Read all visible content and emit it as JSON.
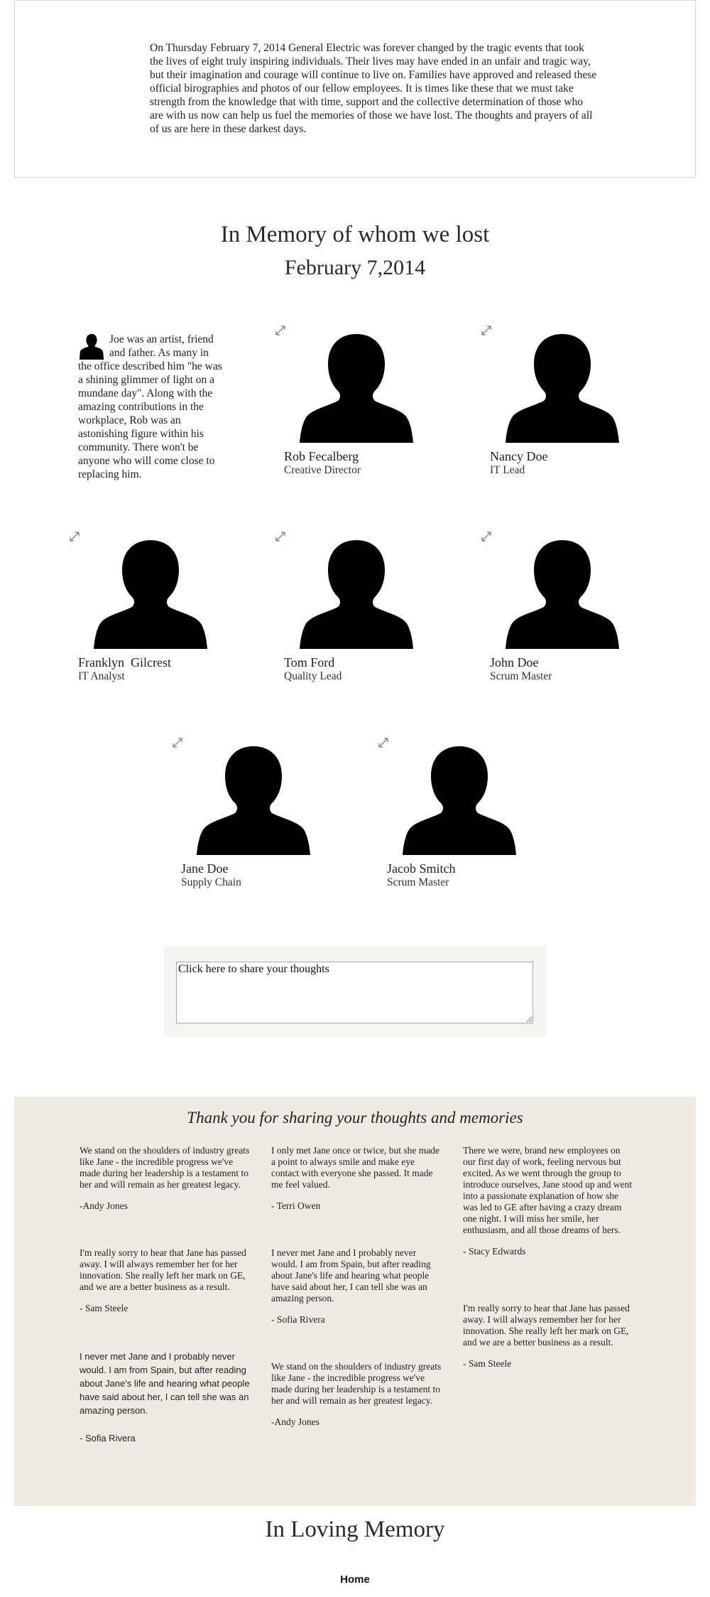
{
  "intro": {
    "text": "On Thursday February 7, 2014 General Electric was forever changed by the tragic events that took the lives of eight truly inspiring individuals. Their lives may have ended in an unfair and tragic way, but their imagination and courage will continue to live on. Families have approved and released these official birographies and photos of our fellow employees. It is times like these that we must take strength from the knowledge that with time, support and the collective determination of those who are with us now can help us fuel the memories of those we have lost. The thoughts and prayers of all of us are here in these darkest days."
  },
  "memorial": {
    "title": "In Memory of whom we lost",
    "date": "February 7,2014"
  },
  "bio": {
    "text": "Joe was an artist, friend and father. As many in the office described him \"he was a shining glimmer of light on a mundane day\". Along with the amazing contributions in the workplace, Rob was an astonishing figure within his community. There won't be anyone who will come close to replacing him."
  },
  "people": [
    {
      "name": "Rob Fecalberg",
      "role": "Creative Director"
    },
    {
      "name": "Nancy Doe",
      "role": "IT Lead"
    },
    {
      "name": "Franklyn  Gilcrest",
      "role": "IT Analyst"
    },
    {
      "name": "Tom Ford",
      "role": "Quality Lead"
    },
    {
      "name": "John Doe",
      "role": "Scrum Master"
    },
    {
      "name": "Jane Doe",
      "role": "Supply Chain"
    },
    {
      "name": "Jacob Smitch",
      "role": "Scrum Master"
    }
  ],
  "share": {
    "value": "Click here to share your thoughts"
  },
  "thoughts": {
    "title": "Thank you for sharing your thoughts and memories",
    "col1": [
      {
        "msg": "We stand on the shoulders of industry greats like Jane - the incredible progress we've made during her leadership is a testament to her and will remain as her greatest legacy.",
        "author": "-Andy Jones"
      },
      {
        "msg": "I'm really sorry to hear that Jane has passed away. I will always remember her for her innovation. She really left her mark on GE, and we are a better business as a result.",
        "author": "- Sam Steele"
      },
      {
        "msg": "I never met Jane and I probably never would. I am from Spain, but after reading about Jane's life and hearing what people have said about her, I can tell she was an amazing person.",
        "author": "- Sofia Rivera"
      }
    ],
    "col2": [
      {
        "msg": "I only met Jane once or twice, but she made a point to always smile and make eye contact with everyone she passed. It made me feel valued.",
        "author": "- Terri Owen"
      },
      {
        "msg": "I never met Jane and I probably never would. I am from Spain, but after reading about Jane's life and hearing what people have said about her, I can tell she was an amazing person.",
        "author": "- Sofia Rivera"
      },
      {
        "msg": "We stand on the shoulders of industry greats like Jane - the incredible progress we've made during her leadership is a testament to her and will remain as her greatest legacy.",
        "author": "-Andy Jones"
      }
    ],
    "col3": [
      {
        "msg": "There we were, brand new employees on our first day of work, feeling nervous but excited. As we went through the group to introduce ourselves, Jane stood up and went into a passionate explanation of how she was led to GE after having a crazy dream one night. I will miss her smile, her enthusiasm, and all those dreams of hers.",
        "author": "- Stacy Edwards"
      },
      {
        "msg": "I'm really sorry to hear that Jane has passed away. I will always remember her for her innovation. She really left her mark on GE, and we are a better business as a result.",
        "author": "- Sam Steele"
      }
    ]
  },
  "footer": {
    "title": "In Loving Memory",
    "home": "Home"
  }
}
